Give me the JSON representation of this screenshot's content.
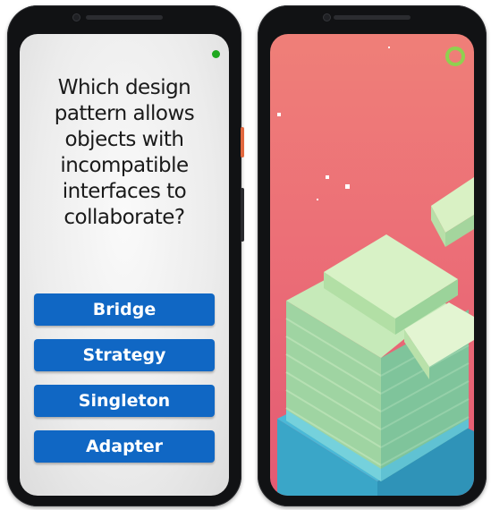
{
  "quiz": {
    "question": "Which design pattern allows objects with incompatible interfaces to collaborate?",
    "answers": [
      "Bridge",
      "Strategy",
      "Singleton",
      "Adapter"
    ],
    "colors": {
      "answer_button": "#1067c4",
      "status_dot": "#1fa81f",
      "screen_background": "#efefef"
    }
  },
  "game": {
    "colors": {
      "background_top": "#ef7f78",
      "background_bottom": "#e35a73",
      "block_top": "#d8f2c6",
      "block_side": "#a9dba6",
      "block_base": "#57c3e0",
      "progress_ring": "#8fd14f"
    }
  },
  "device": {
    "frame_color": "#111214",
    "side_button_color": "#e2683f"
  }
}
